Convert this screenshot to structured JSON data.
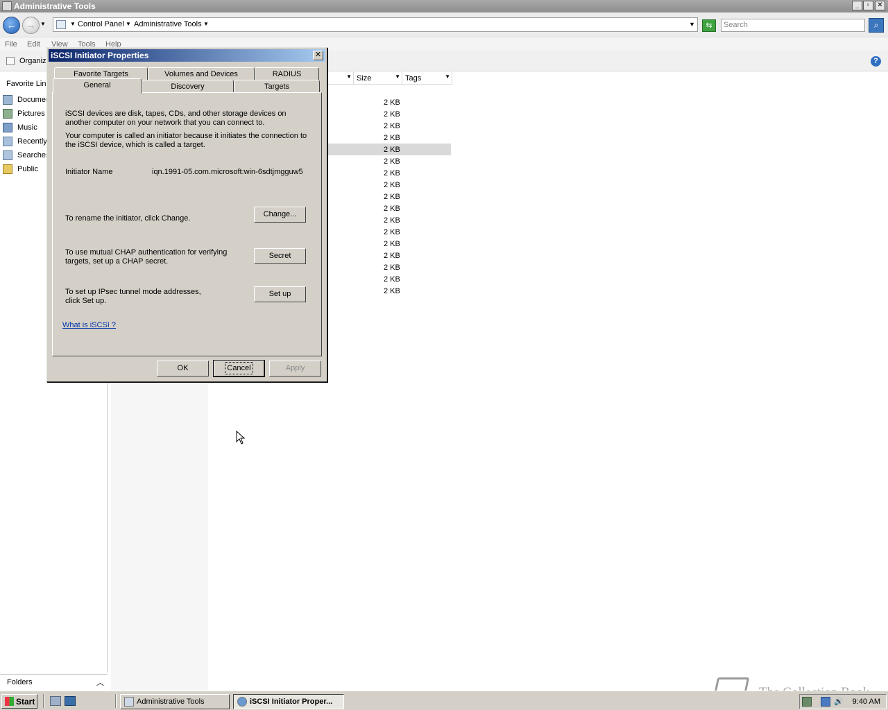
{
  "window": {
    "title": "Administrative Tools"
  },
  "address": {
    "crumbs": [
      "Control Panel",
      "Administrative Tools"
    ],
    "search_placeholder": "Search"
  },
  "menubar": {
    "items": [
      "File",
      "Edit",
      "View",
      "Tools",
      "Help"
    ]
  },
  "toolbar": {
    "organize": "Organiz"
  },
  "navpane": {
    "header": "Favorite Lin",
    "items": [
      {
        "label": "Documer",
        "icon": "documents-icon"
      },
      {
        "label": "Pictures",
        "icon": "pictures-icon"
      },
      {
        "label": "Music",
        "icon": "music-icon"
      },
      {
        "label": "Recently",
        "icon": "recent-icon"
      },
      {
        "label": "Searches",
        "icon": "searches-icon"
      },
      {
        "label": "Public",
        "icon": "folder-icon"
      }
    ],
    "folders_label": "Folders"
  },
  "filelist": {
    "columns": [
      "Size",
      "Tags"
    ],
    "sizes": [
      "2 KB",
      "2 KB",
      "2 KB",
      "2 KB",
      "2 KB",
      "2 KB",
      "2 KB",
      "2 KB",
      "2 KB",
      "2 KB",
      "2 KB",
      "2 KB",
      "2 KB",
      "2 KB",
      "2 KB",
      "2 KB",
      "2 KB"
    ]
  },
  "dialog": {
    "title": "iSCSI Initiator Properties",
    "tabs_row1": [
      "Favorite Targets",
      "Volumes and Devices",
      "RADIUS"
    ],
    "tabs_row2": [
      "General",
      "Discovery",
      "Targets"
    ],
    "active_tab": "General",
    "intro1": "iSCSI devices are disk, tapes, CDs, and other storage devices on another computer on your network that you can connect to.",
    "intro2": "Your computer is called an initiator because it initiates the connection to the iSCSI device, which is called a target.",
    "initiator_label": "Initiator Name",
    "initiator_value": "iqn.1991-05.com.microsoft:win-6sdtjmgguw5",
    "rename_text": "To rename the initiator, click Change.",
    "change_label": "Change...",
    "chap_text": "To use mutual CHAP authentication for verifying targets, set up a CHAP secret.",
    "secret_label": "Secret",
    "ipsec_text": "To set up IPsec tunnel mode addresses, click Set up.",
    "setup_label": "Set up",
    "help_link": "What is iSCSI ?",
    "ok_label": "OK",
    "cancel_label": "Cancel",
    "apply_label": "Apply"
  },
  "taskbar": {
    "start_label": "Start",
    "tasks": [
      "Administrative Tools",
      "iSCSI Initiator Proper..."
    ],
    "clock": "9:40 AM"
  },
  "watermark": "The Collection Book"
}
